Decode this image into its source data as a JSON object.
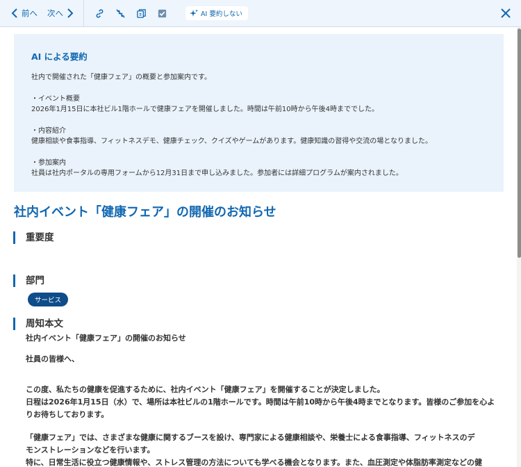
{
  "toolbar": {
    "prev_label": "前へ",
    "next_label": "次へ",
    "ai_label": "AI 要約しない"
  },
  "summary": {
    "title": "AI による要約",
    "intro": "社内で開催された「健康フェア」の概要と参加案内です。",
    "sections": [
      {
        "heading": "・イベント概要",
        "text": "2026年1月15日に本社ビル1階ホールで健康フェアを開催しました。時間は午前10時から午後4時まででした。"
      },
      {
        "heading": "・内容紹介",
        "text": "健康相談や食事指導、フィットネスデモ、健康チェック、クイズやゲームがあります。健康知識の習得や交流の場となりました。"
      },
      {
        "heading": "・参加案内",
        "text": "社員は社内ポータルの専用フォームから12月31日まで申し込みました。参加者には詳細プログラムが案内されました。"
      }
    ]
  },
  "document": {
    "title": "社内イベント「健康フェア」の開催のお知らせ",
    "importance_heading": "重要度",
    "department_heading": "部門",
    "department_tag": "サービス",
    "body_heading": "周知本文",
    "body_title": "社内イベント「健康フェア」の開催のお知らせ",
    "greeting": "社員の皆様へ、",
    "paragraph1": [
      "この度、私たちの健康を促進するために、社内イベント「健康フェア」を開催することが決定しました。",
      "日程は2026年1月15日（水）で、場所は本社ビルの1階ホールです。時間は午前10時から午後4時までとなります。皆様のご参加を心よ",
      "りお待ちしております。"
    ],
    "paragraph2": [
      "「健康フェア」では、さまざまな健康に関するブースを設け、専門家による健康相談や、栄養士による食事指導、フィットネスのデ",
      "モンストレーションなどを行います。",
      "特に、日常生活に役立つ健康情報や、ストレス管理の方法についても学べる機会となります。また、血圧測定や体脂肪率測定などの健"
    ]
  },
  "colors": {
    "accent": "#1167b1",
    "toolbar_bg": "#eef5fc",
    "summary_bg": "#eaf3fb",
    "tag_bg": "#0f4c8a"
  }
}
